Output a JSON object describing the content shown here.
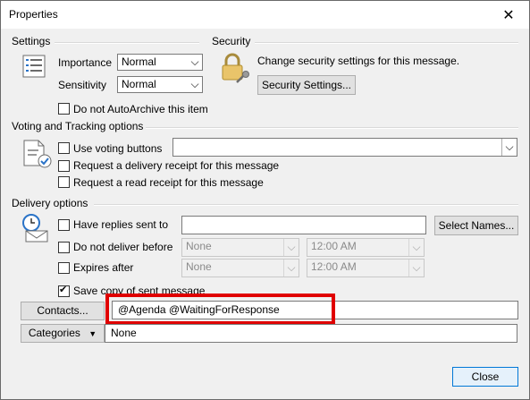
{
  "window": {
    "title": "Properties"
  },
  "settings": {
    "section": "Settings",
    "importance_label": "Importance",
    "importance_value": "Normal",
    "sensitivity_label": "Sensitivity",
    "sensitivity_value": "Normal",
    "autoarchive_label": "Do not AutoArchive this item"
  },
  "security": {
    "section": "Security",
    "description": "Change security settings for this message.",
    "button_label": "Security Settings..."
  },
  "voting": {
    "section": "Voting and Tracking options",
    "use_voting_label": "Use voting buttons",
    "use_voting_value": "",
    "delivery_receipt_label": "Request a delivery receipt for this message",
    "read_receipt_label": "Request a read receipt for this message"
  },
  "delivery": {
    "section": "Delivery options",
    "replies_label": "Have replies sent to",
    "replies_value": "",
    "select_names_label": "Select Names...",
    "do_not_deliver_label": "Do not deliver before",
    "do_not_deliver_date": "None",
    "do_not_deliver_time": "12:00 AM",
    "expires_label": "Expires after",
    "expires_date": "None",
    "expires_time": "12:00 AM",
    "save_copy_label": "Save copy of sent message"
  },
  "contacts": {
    "button_label": "Contacts...",
    "value": "@Agenda @WaitingForResponse"
  },
  "categories": {
    "button_label": "Categories",
    "value": "None"
  },
  "footer": {
    "close_label": "Close"
  },
  "colors": {
    "highlight_box": "#e00000",
    "primary_border": "#0078d7"
  }
}
